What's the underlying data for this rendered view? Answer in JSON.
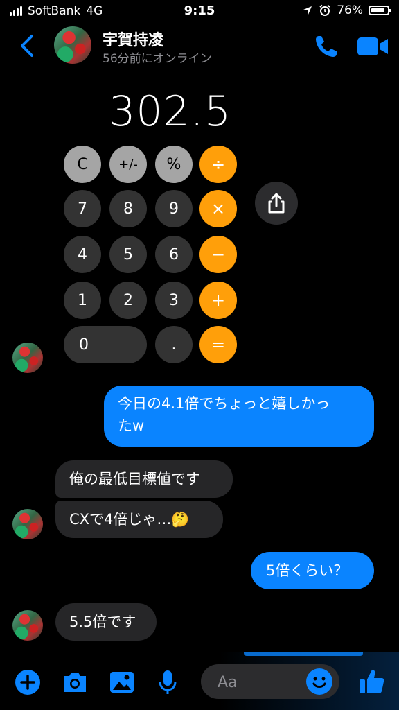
{
  "status_bar": {
    "carrier": "SoftBank",
    "network": "4G",
    "time": "9:15",
    "battery": "76%"
  },
  "header": {
    "name": "宇賀持凌",
    "status": "56分前にオンライン"
  },
  "calculator": {
    "display": "302.5",
    "keys": [
      "C",
      "+/-",
      "%",
      "÷",
      "7",
      "8",
      "9",
      "×",
      "4",
      "5",
      "6",
      "−",
      "1",
      "2",
      "3",
      "+",
      "0",
      ".",
      "="
    ]
  },
  "messages": [
    {
      "from": "me",
      "text_lines": [
        "今日の4.1倍でちょっと嬉しかっ",
        "たw"
      ]
    },
    {
      "from": "them",
      "text": "俺の最低目標値です"
    },
    {
      "from": "them",
      "text": "CXで4倍じゃ…🤔"
    },
    {
      "from": "me",
      "text": "5倍くらい？"
    },
    {
      "from": "them",
      "text": "5.5倍です"
    }
  ],
  "composer": {
    "placeholder": "Aa"
  },
  "colors": {
    "accent": "#0a84ff",
    "calc_orange": "#ff9f0a",
    "calc_gray": "#a5a5a5",
    "calc_dark": "#333333"
  }
}
